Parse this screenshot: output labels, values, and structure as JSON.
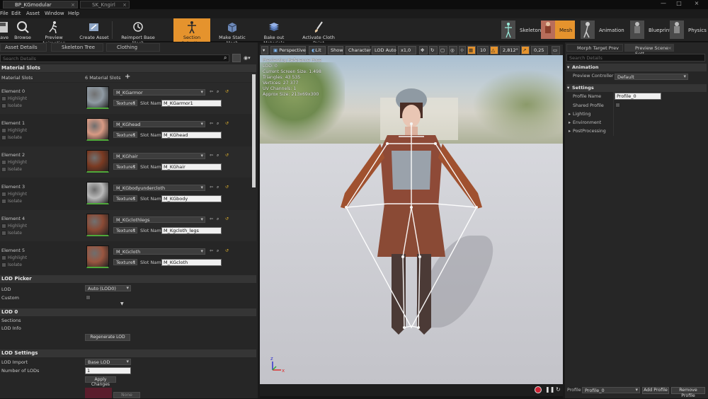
{
  "doc_tabs": [
    "BP_KGmodular",
    "SK_Kngirl"
  ],
  "menu": [
    "File",
    "Edit",
    "Asset",
    "Window",
    "Help"
  ],
  "toolbar": {
    "buttons": [
      "Save",
      "Browse",
      "Preview Animation",
      "Create Asset",
      "Reimport Base Mesh",
      "Section Selection",
      "Make Static Mesh",
      "Bake out Materials",
      "Activate Cloth Paint"
    ],
    "active": "Section Selection",
    "modes": [
      "Skeleton",
      "Mesh",
      "Animation",
      "Blueprint",
      "Physics"
    ],
    "active_mode": "Mesh"
  },
  "left_tabs": [
    "Asset Details",
    "Skeleton Tree",
    "Clothing"
  ],
  "left_search_placeholder": "Search Details",
  "material_slots": {
    "section": "Material Slots",
    "header_label": "Material Slots",
    "count": "6 Material Slots",
    "highlight": "Highlight",
    "isolate": "Isolate",
    "textures": "Textures",
    "slot_name_label": "Slot Name",
    "elements": [
      {
        "label": "Element 0",
        "material": "M_KGarmor",
        "slot": "M_KGarmor1",
        "color": "#8f9aa3"
      },
      {
        "label": "Element 1",
        "material": "M_KGhead",
        "slot": "M_KGhead",
        "color": "#d89a84"
      },
      {
        "label": "Element 2",
        "material": "M_KGhair",
        "slot": "M_KGhair",
        "color": "#7a3a22"
      },
      {
        "label": "Element 3",
        "material": "M_KGbodyundercloth",
        "slot": "M_KGbody",
        "color": "#b9b9b9"
      },
      {
        "label": "Element 4",
        "material": "M_KGclothlegs",
        "slot": "M_Kgcloth_legs",
        "color": "#8a4a35"
      },
      {
        "label": "Element 5",
        "material": "M_KGcloth",
        "slot": "M_KGcloth",
        "color": "#9a5640"
      }
    ]
  },
  "lod_picker": {
    "section": "LOD Picker",
    "lod_label": "LOD",
    "lod_value": "Auto (LOD0)",
    "custom_label": "Custom"
  },
  "lod0": {
    "section": "LOD 0",
    "sections": "Sections",
    "lod_info": "LOD Info",
    "regenerate": "Regenerate LOD"
  },
  "lod_settings": {
    "section": "LOD Settings",
    "import_label": "LOD Import",
    "import_value": "Base LOD",
    "num_label": "Number of LODs",
    "num_value": "1",
    "apply": "Apply Changes",
    "none": "None"
  },
  "viewport": {
    "buttons": [
      "Perspective",
      "Lit",
      "Show",
      "Character",
      "LOD Auto",
      "x1,0"
    ],
    "grid_value": "10",
    "angle_value": "2,812°",
    "scale_value": "0,25",
    "stats": [
      "Previewing Reference Pose",
      "LOD: 0",
      "Current Screen Size: 1,498",
      "Triangles: 43 535",
      "Vertices: 27 377",
      "UV Channels: 1",
      "Approx Size: 213x69x300"
    ]
  },
  "right_tabs": [
    "Morph Target Prev",
    "Preview Scene Sett"
  ],
  "right_search_placeholder": "Search Details",
  "scene": {
    "animation_section": "Animation",
    "preview_controller_label": "Preview Controller",
    "preview_controller_value": "Default",
    "settings_section": "Settings",
    "profile_name_label": "Profile Name",
    "profile_name_value": "Profile_0",
    "shared_profile_label": "Shared Profile",
    "lighting": "Lighting",
    "environment": "Environment",
    "postprocessing": "PostProcessing",
    "profile_label": "Profile",
    "profile_value": "Profile_0",
    "add_profile": "Add Profile",
    "remove_profile": "Remove Profile"
  }
}
